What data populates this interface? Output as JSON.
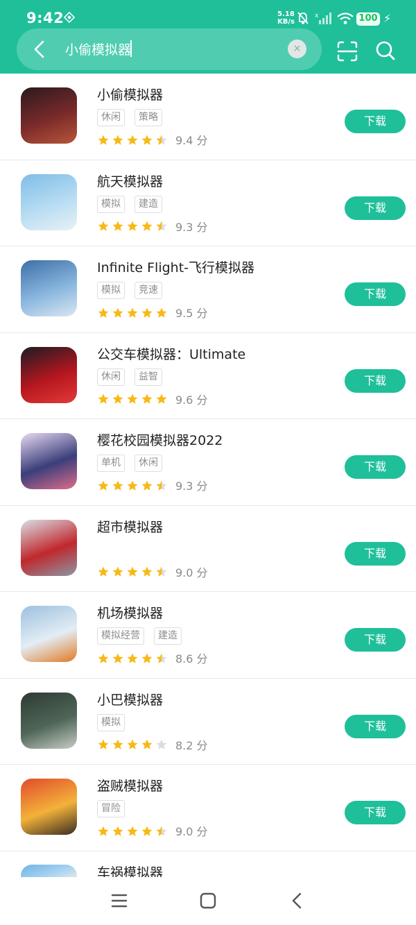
{
  "status_bar": {
    "time": "9:42",
    "net_speed_value": "5.18",
    "net_speed_unit": "KB/s",
    "battery": "100"
  },
  "search": {
    "query": "小偷模拟器",
    "clear_icon": "×"
  },
  "download_label": "下载",
  "score_unit": "分",
  "apps": [
    {
      "name": "小偷模拟器",
      "tags": [
        "休闲",
        "策略"
      ],
      "stars": 4.5,
      "score": "9.4",
      "icon_colors": [
        "#2a1a1f",
        "#7a2a2a",
        "#b8563a"
      ]
    },
    {
      "name": "航天模拟器",
      "tags": [
        "模拟",
        "建造"
      ],
      "stars": 4.5,
      "score": "9.3",
      "icon_colors": [
        "#7fbde6",
        "#b7dcf3",
        "#e9f1f5"
      ]
    },
    {
      "name": "Infinite Flight-飞行模拟器",
      "tags": [
        "模拟",
        "竞速"
      ],
      "stars": 5,
      "score": "9.5",
      "icon_colors": [
        "#3d6fa8",
        "#89b6de",
        "#d9e6f2"
      ]
    },
    {
      "name": "公交车模拟器：Ultimate",
      "tags": [
        "休闲",
        "益智"
      ],
      "stars": 5,
      "score": "9.6",
      "icon_colors": [
        "#1c1c24",
        "#b5161e",
        "#e23a3a"
      ]
    },
    {
      "name": "樱花校园模拟器2022",
      "tags": [
        "单机",
        "休闲"
      ],
      "stars": 4.5,
      "score": "9.3",
      "icon_colors": [
        "#e8d9f2",
        "#3a3f7a",
        "#e06b8b"
      ]
    },
    {
      "name": "超市模拟器",
      "tags": [],
      "stars": 4.5,
      "score": "9.0",
      "icon_colors": [
        "#d9dfe6",
        "#c0282d",
        "#8b96a5"
      ]
    },
    {
      "name": "机场模拟器",
      "tags": [
        "模拟经营",
        "建造"
      ],
      "stars": 4.5,
      "score": "8.6",
      "icon_colors": [
        "#9cc0de",
        "#e3edf5",
        "#e07a24"
      ]
    },
    {
      "name": "小巴模拟器",
      "tags": [
        "模拟"
      ],
      "stars": 4,
      "score": "8.2",
      "icon_colors": [
        "#2f3a33",
        "#4e6657",
        "#c7ccc6"
      ]
    },
    {
      "name": "盗贼模拟器",
      "tags": [
        "冒险"
      ],
      "stars": 4.5,
      "score": "9.0",
      "icon_colors": [
        "#e24b2b",
        "#f2b23a",
        "#3a2c22"
      ]
    }
  ],
  "partial_app": {
    "name": "车祸模拟器",
    "icon_colors": [
      "#6fb3e6",
      "#a8d3f2",
      "#f5f1e6"
    ]
  },
  "colors": {
    "accent": "#1fbf9a",
    "star_filled": "#f7b916",
    "star_empty": "#dcdcdc"
  },
  "icons": {
    "back": "chevron-left-icon",
    "scan": "scan-icon",
    "search": "search-icon",
    "nav_menu": "menu-icon",
    "nav_home": "home-square-icon",
    "nav_back": "back-triangle-icon"
  }
}
